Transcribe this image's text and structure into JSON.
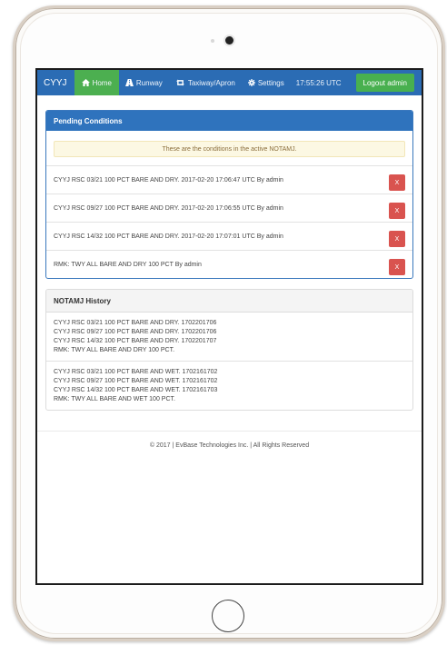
{
  "navbar": {
    "brand": "CYYJ",
    "items": [
      {
        "label": "Home",
        "icon": "home-icon"
      },
      {
        "label": "Runway",
        "icon": "road-icon"
      },
      {
        "label": "Taxiway/Apron",
        "icon": "retweet-icon"
      },
      {
        "label": "Settings",
        "icon": "gear-icon"
      }
    ],
    "time": "17:55:26 UTC",
    "logout": "Logout admin"
  },
  "colors": {
    "navbar": "#2b6cb4",
    "active": "#4caf50",
    "danger": "#d9534f",
    "panel_primary": "#2f73bd",
    "alert_bg": "#fcf8e3"
  },
  "pending": {
    "title": "Pending Conditions",
    "alert": "These are the conditions in the active NOTAMJ.",
    "rows": [
      {
        "text": "CYYJ RSC 03/21 100 PCT BARE AND DRY. 2017-02-20 17:06:47 UTC By admin",
        "button": "X"
      },
      {
        "text": "CYYJ RSC 09/27 100 PCT BARE AND DRY. 2017-02-20 17:06:55 UTC By admin",
        "button": "X"
      },
      {
        "text": "CYYJ RSC 14/32 100 PCT BARE AND DRY. 2017-02-20 17:07:01 UTC By admin",
        "button": "X"
      },
      {
        "text": "RMK: TWY ALL BARE AND DRY 100 PCT By admin",
        "button": "X"
      }
    ]
  },
  "history": {
    "title": "NOTAMJ History",
    "blocks": [
      {
        "lines": [
          "CYYJ RSC 03/21 100 PCT BARE AND DRY. 1702201706",
          "CYYJ RSC 09/27 100 PCT BARE AND DRY. 1702201706",
          "CYYJ RSC 14/32 100 PCT BARE AND DRY. 1702201707",
          "RMK: TWY ALL BARE AND DRY 100 PCT."
        ]
      },
      {
        "lines": [
          "CYYJ RSC 03/21 100 PCT BARE AND WET. 1702161702",
          "CYYJ RSC 09/27 100 PCT BARE AND WET. 1702161702",
          "CYYJ RSC 14/32 100 PCT BARE AND WET. 1702161703",
          "RMK: TWY ALL BARE AND WET 100 PCT."
        ]
      }
    ]
  },
  "footer": "© 2017 | EvBase Technologies Inc. | All Rights Reserved"
}
